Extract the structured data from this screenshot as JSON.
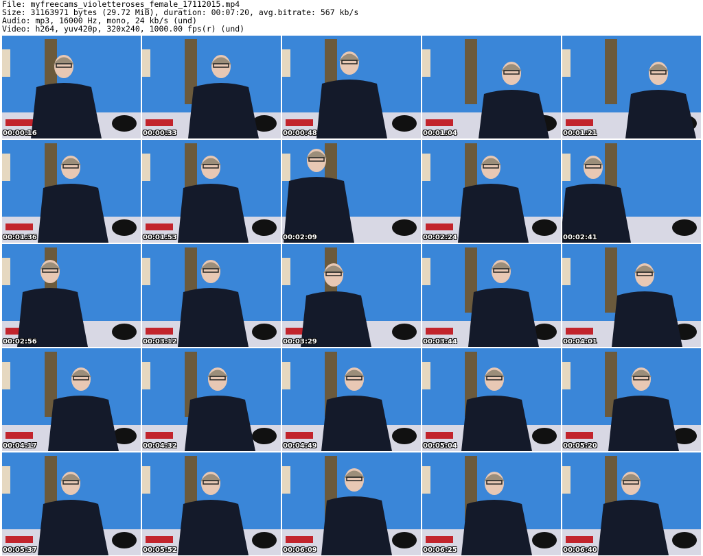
{
  "header": {
    "file_line": "File: myfreecams_violetteroses_female_17112015.mp4",
    "size_line": "Size: 31163971 bytes (29.72 MiB), duration: 00:07:20, avg.bitrate: 567 kb/s",
    "audio_line": "Audio: mp3, 16000 Hz, mono, 24 kb/s (und)",
    "video_line": "Video: h264, yuv420p, 320x240, 1000.00 fps(r) (und)"
  },
  "thumbnails": [
    {
      "timestamp": "00:00:16"
    },
    {
      "timestamp": "00:00:33"
    },
    {
      "timestamp": "00:00:48"
    },
    {
      "timestamp": "00:01:04"
    },
    {
      "timestamp": "00:01:21"
    },
    {
      "timestamp": "00:01:36"
    },
    {
      "timestamp": "00:01:53"
    },
    {
      "timestamp": "00:02:09"
    },
    {
      "timestamp": "00:02:24"
    },
    {
      "timestamp": "00:02:41"
    },
    {
      "timestamp": "00:02:56"
    },
    {
      "timestamp": "00:03:12"
    },
    {
      "timestamp": "00:03:29"
    },
    {
      "timestamp": "00:03:44"
    },
    {
      "timestamp": "00:04:01"
    },
    {
      "timestamp": "00:04:17"
    },
    {
      "timestamp": "00:04:32"
    },
    {
      "timestamp": "00:04:49"
    },
    {
      "timestamp": "00:05:04"
    },
    {
      "timestamp": "00:05:20"
    },
    {
      "timestamp": "00:05:37"
    },
    {
      "timestamp": "00:05:52"
    },
    {
      "timestamp": "00:06:09"
    },
    {
      "timestamp": "00:06:25"
    },
    {
      "timestamp": "00:06:40"
    }
  ],
  "colors": {
    "wall": "#3a86d8",
    "shirt": "#141a2a",
    "skin": "#e8c8b4",
    "hair": "#9c8e7a",
    "door": "#6b5a3c",
    "bed": "#d8d8e4",
    "red_item": "#c2242c",
    "timestamp_text": "#ffffff"
  }
}
